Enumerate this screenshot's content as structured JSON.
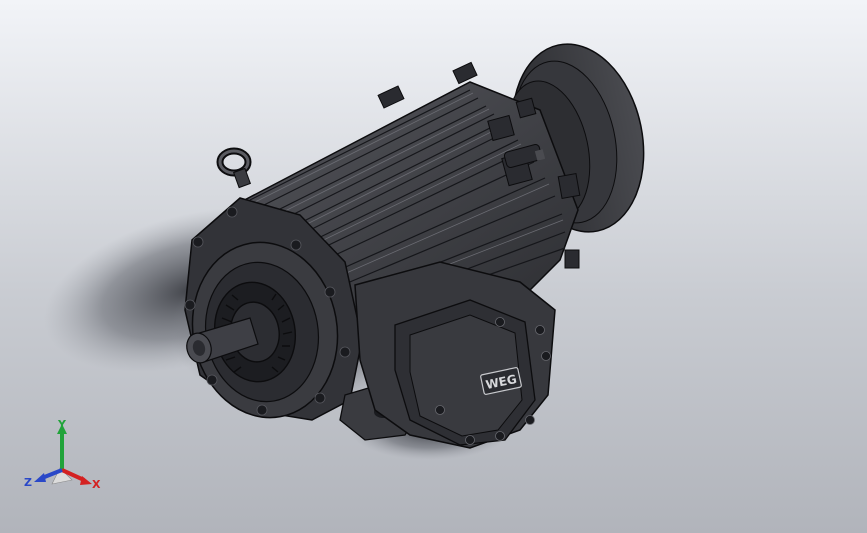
{
  "viewport": {
    "background_top": "#f2f4f8",
    "background_bottom": "#b1b4bb"
  },
  "model": {
    "brand_plate_text": "WEG",
    "body_color": "#3c3d42",
    "dark_color": "#222327",
    "edge_color": "#0c0c0e"
  },
  "triad": {
    "x_label": "X",
    "y_label": "Y",
    "z_label": "Z",
    "x_color": "#d42121",
    "y_color": "#21a33a",
    "z_color": "#2a48c8"
  }
}
